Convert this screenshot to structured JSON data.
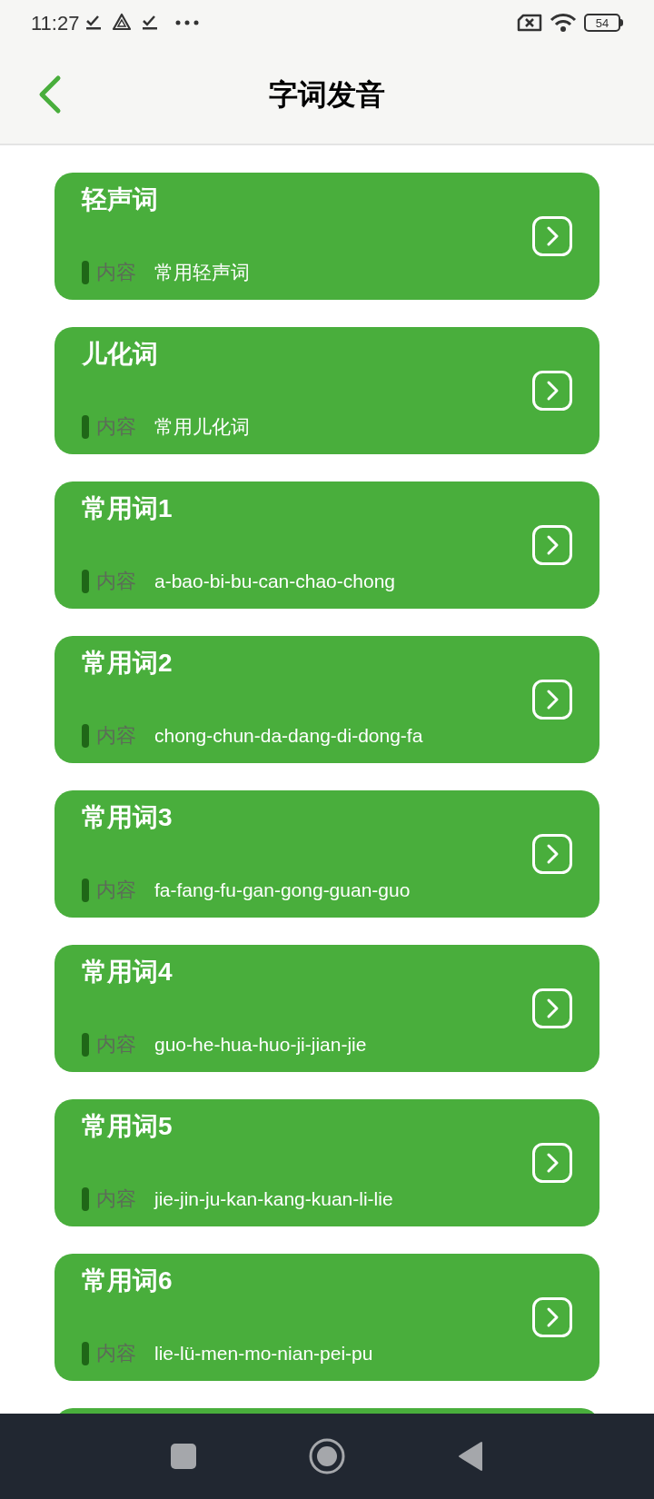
{
  "status_bar": {
    "time": "11:27",
    "battery": "54"
  },
  "header": {
    "title": "字词发音"
  },
  "cards": [
    {
      "kind": "full",
      "title": "轻声词",
      "label": "内容",
      "content": "常用轻声词"
    },
    {
      "kind": "full",
      "title": "儿化词",
      "label": "内容",
      "content": "常用儿化词"
    },
    {
      "kind": "full",
      "title": "常用词1",
      "label": "内容",
      "content": "a-bao-bi-bu-can-chao-chong"
    },
    {
      "kind": "full",
      "title": "常用词2",
      "label": "内容",
      "content": "chong-chun-da-dang-di-dong-fa"
    },
    {
      "kind": "full",
      "title": "常用词3",
      "label": "内容",
      "content": "fa-fang-fu-gan-gong-guan-guo"
    },
    {
      "kind": "full",
      "title": "常用词4",
      "label": "内容",
      "content": "guo-he-hua-huo-ji-jian-jie"
    },
    {
      "kind": "full",
      "title": "常用词5",
      "label": "内容",
      "content": "jie-jin-ju-kan-kang-kuan-li-lie"
    },
    {
      "kind": "full",
      "title": "常用词6",
      "label": "内容",
      "content": "lie-lü-men-mo-nian-pei-pu"
    },
    {
      "kind": "cut_off"
    }
  ]
}
